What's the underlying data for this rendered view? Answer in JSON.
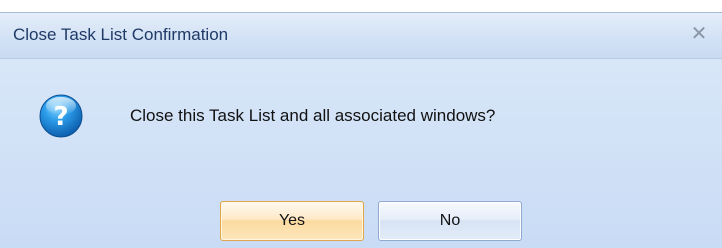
{
  "dialog": {
    "title": "Close Task List Confirmation",
    "close_glyph": "✕",
    "icon": "question-icon",
    "message": "Close this Task List and all associated windows?",
    "buttons": {
      "yes_label": "Yes",
      "no_label": "No"
    }
  },
  "colors": {
    "title_text": "#1f3a66",
    "body_bg": "#c9dcf5",
    "icon_blue": "#1f7fd1",
    "default_button_border": "#e2a64a",
    "button_border": "#8fa9cf"
  }
}
